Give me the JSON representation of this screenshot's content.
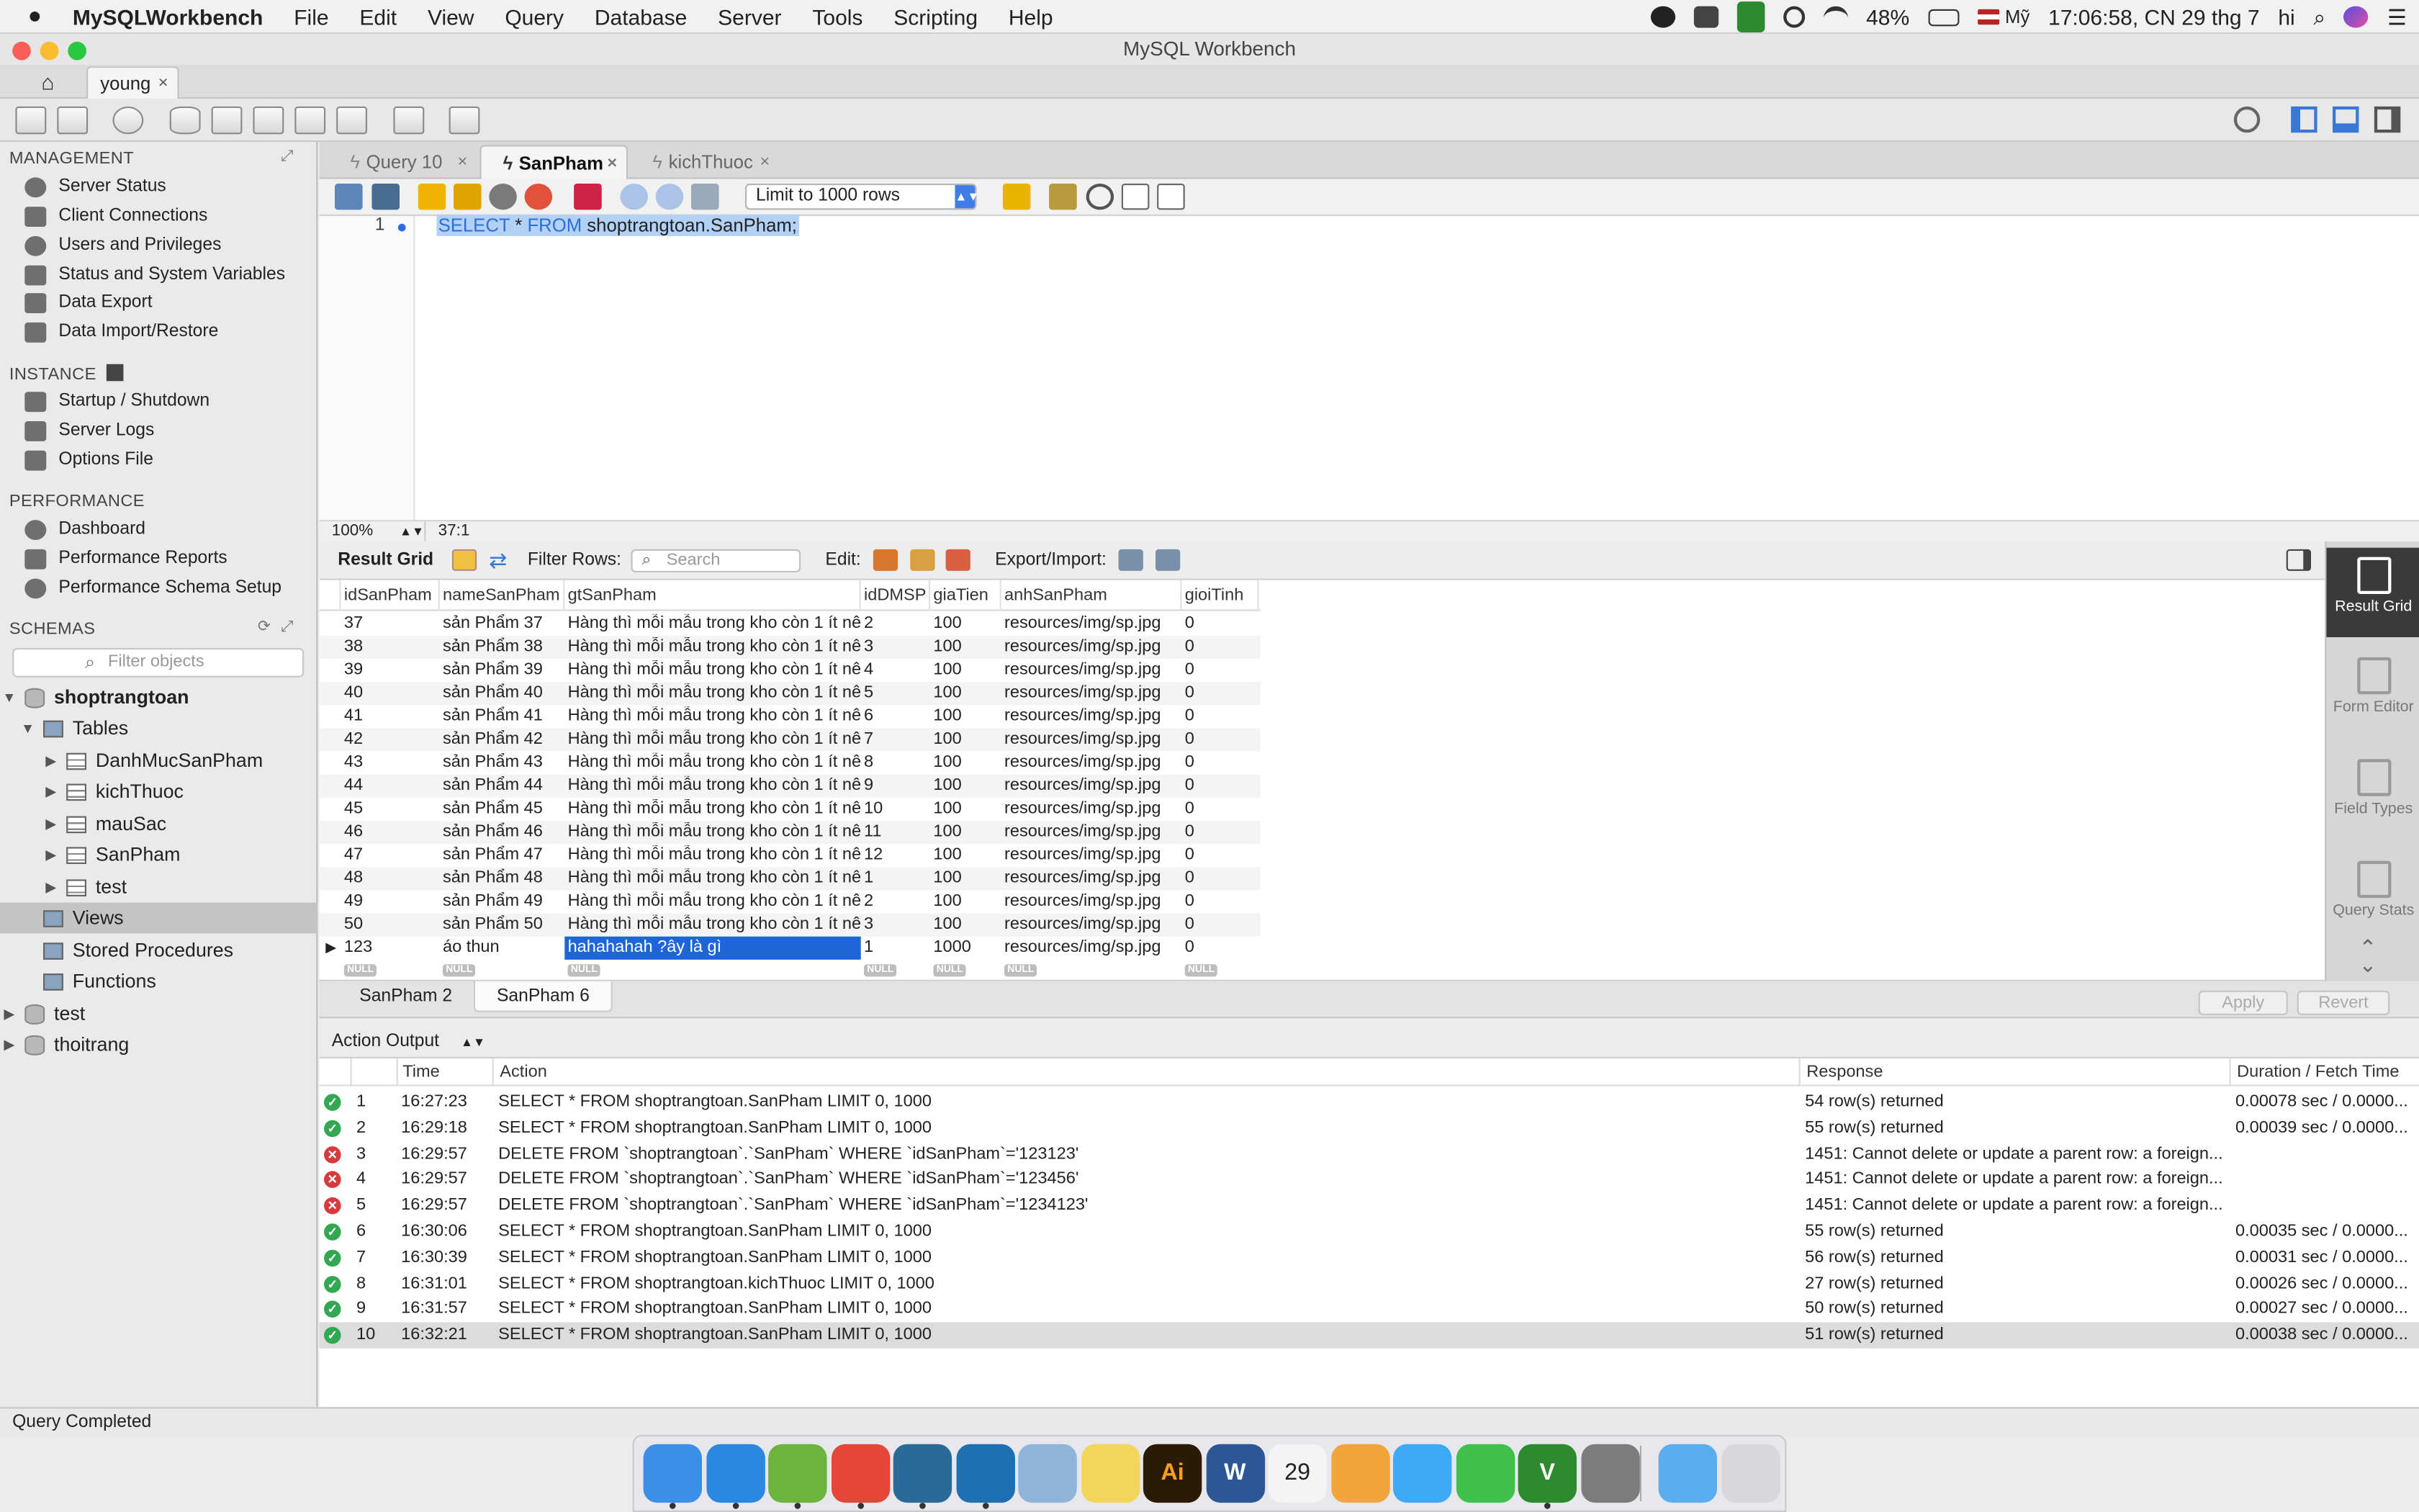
{
  "menubar": {
    "apple": "",
    "app": "MySQLWorkbench",
    "items": [
      "File",
      "Edit",
      "View",
      "Query",
      "Database",
      "Server",
      "Tools",
      "Scripting",
      "Help"
    ],
    "battery": "48%",
    "input_source": "Mỹ",
    "clock": "17:06:58, CN 29 thg 7",
    "user": "hi"
  },
  "window": {
    "title": "MySQL Workbench",
    "conn_tab": "young",
    "conn_tab_close": "×",
    "home_icon": "⌂"
  },
  "sidebar": {
    "management_title": "MANAGEMENT",
    "management": [
      "Server Status",
      "Client Connections",
      "Users and Privileges",
      "Status and System Variables",
      "Data Export",
      "Data Import/Restore"
    ],
    "instance_title": "INSTANCE",
    "instance": [
      "Startup / Shutdown",
      "Server Logs",
      "Options File"
    ],
    "performance_title": "PERFORMANCE",
    "performance": [
      "Dashboard",
      "Performance Reports",
      "Performance Schema Setup"
    ],
    "schemas_title": "SCHEMAS",
    "filter_placeholder": "Filter objects",
    "schema_main": "shoptrangtoan",
    "tables_label": "Tables",
    "tables": [
      "DanhMucSanPham",
      "kichThuoc",
      "mauSac",
      "SanPham",
      "test"
    ],
    "views_label": "Views",
    "procs_label": "Stored Procedures",
    "funcs_label": "Functions",
    "other_schemas": [
      "test",
      "thoitrang"
    ]
  },
  "query_tabs": [
    {
      "label": "Query 10"
    },
    {
      "label": "SanPham"
    },
    {
      "label": "kichThuoc"
    }
  ],
  "editor": {
    "limit": "Limit to 1000 rows",
    "line": "1",
    "kw1": "SELECT",
    "star": " * ",
    "kw2": "FROM",
    "rest": " shoptrangtoan.SanPham;",
    "zoom": "100%",
    "position": "37:1"
  },
  "result_toolbar": {
    "result_grid": "Result Grid",
    "filter_rows": "Filter Rows:",
    "search_placeholder": "Search",
    "edit": "Edit:",
    "export_import": "Export/Import:"
  },
  "grid": {
    "columns": [
      "idSanPham",
      "nameSanPham",
      "gtSanPham",
      "idDMSP",
      "giaTien",
      "anhSanPham",
      "gioiTinh"
    ],
    "rows": [
      [
        "37",
        "sản Phẩm 37",
        "Hàng thì mỗi mẫu trong kho còn 1 ít nê...",
        "2",
        "100",
        "resources/img/sp.jpg",
        "0"
      ],
      [
        "38",
        "sản Phẩm 38",
        "Hàng thì mỗi mẫu trong kho còn 1 ít nê...",
        "3",
        "100",
        "resources/img/sp.jpg",
        "0"
      ],
      [
        "39",
        "sản Phẩm 39",
        "Hàng thì mỗi mẫu trong kho còn 1 ít nê...",
        "4",
        "100",
        "resources/img/sp.jpg",
        "0"
      ],
      [
        "40",
        "sản Phẩm 40",
        "Hàng thì mỗi mẫu trong kho còn 1 ít nê...",
        "5",
        "100",
        "resources/img/sp.jpg",
        "0"
      ],
      [
        "41",
        "sản Phẩm 41",
        "Hàng thì mỗi mẫu trong kho còn 1 ít nê...",
        "6",
        "100",
        "resources/img/sp.jpg",
        "0"
      ],
      [
        "42",
        "sản Phẩm 42",
        "Hàng thì mỗi mẫu trong kho còn 1 ít nê...",
        "7",
        "100",
        "resources/img/sp.jpg",
        "0"
      ],
      [
        "43",
        "sản Phẩm 43",
        "Hàng thì mỗi mẫu trong kho còn 1 ít nê...",
        "8",
        "100",
        "resources/img/sp.jpg",
        "0"
      ],
      [
        "44",
        "sản Phẩm 44",
        "Hàng thì mỗi mẫu trong kho còn 1 ít nê...",
        "9",
        "100",
        "resources/img/sp.jpg",
        "0"
      ],
      [
        "45",
        "sản Phẩm 45",
        "Hàng thì mỗi mẫu trong kho còn 1 ít nê...",
        "10",
        "100",
        "resources/img/sp.jpg",
        "0"
      ],
      [
        "46",
        "sản Phẩm 46",
        "Hàng thì mỗi mẫu trong kho còn 1 ít nê...",
        "11",
        "100",
        "resources/img/sp.jpg",
        "0"
      ],
      [
        "47",
        "sản Phẩm 47",
        "Hàng thì mỗi mẫu trong kho còn 1 ít nê...",
        "12",
        "100",
        "resources/img/sp.jpg",
        "0"
      ],
      [
        "48",
        "sản Phẩm 48",
        "Hàng thì mỗi mẫu trong kho còn 1 ít nê...",
        "1",
        "100",
        "resources/img/sp.jpg",
        "0"
      ],
      [
        "49",
        "sản Phẩm 49",
        "Hàng thì mỗi mẫu trong kho còn 1 ít nê...",
        "2",
        "100",
        "resources/img/sp.jpg",
        "0"
      ],
      [
        "50",
        "sản Phẩm 50",
        "Hàng thì mỗi mẫu trong kho còn 1 ít nê...",
        "3",
        "100",
        "resources/img/sp.jpg",
        "0"
      ],
      [
        "123",
        "áo thun",
        "hahahahah ?ây là gì",
        "1",
        "1000",
        "resources/img/sp.jpg",
        "0"
      ]
    ],
    "null_label": "NULL",
    "current_marker": "▶"
  },
  "right_panel": [
    {
      "label": "Result Grid"
    },
    {
      "label": "Form Editor"
    },
    {
      "label": "Field Types"
    },
    {
      "label": "Query Stats"
    }
  ],
  "result_tabs": [
    "SanPham 2",
    "SanPham 6"
  ],
  "buttons": {
    "apply": "Apply",
    "revert": "Revert"
  },
  "action_output": {
    "title": "Action Output",
    "columns": [
      "Time",
      "Action",
      "Response",
      "Duration / Fetch Time"
    ],
    "rows": [
      {
        "status": "ok",
        "n": "1",
        "time": "16:27:23",
        "action": "SELECT * FROM shoptrangtoan.SanPham LIMIT 0, 1000",
        "response": "54 row(s) returned",
        "duration": "0.00078 sec / 0.0000..."
      },
      {
        "status": "ok",
        "n": "2",
        "time": "16:29:18",
        "action": "SELECT * FROM shoptrangtoan.SanPham LIMIT 0, 1000",
        "response": "55 row(s) returned",
        "duration": "0.00039 sec / 0.0000..."
      },
      {
        "status": "err",
        "n": "3",
        "time": "16:29:57",
        "action": "DELETE FROM `shoptrangtoan`.`SanPham` WHERE `idSanPham`='123123'",
        "response": "1451: Cannot delete or update a parent row: a foreign...",
        "duration": ""
      },
      {
        "status": "err",
        "n": "4",
        "time": "16:29:57",
        "action": "DELETE FROM `shoptrangtoan`.`SanPham` WHERE `idSanPham`='123456'",
        "response": "1451: Cannot delete or update a parent row: a foreign...",
        "duration": ""
      },
      {
        "status": "err",
        "n": "5",
        "time": "16:29:57",
        "action": "DELETE FROM `shoptrangtoan`.`SanPham` WHERE `idSanPham`='1234123'",
        "response": "1451: Cannot delete or update a parent row: a foreign...",
        "duration": ""
      },
      {
        "status": "ok",
        "n": "6",
        "time": "16:30:06",
        "action": "SELECT * FROM shoptrangtoan.SanPham LIMIT 0, 1000",
        "response": "55 row(s) returned",
        "duration": "0.00035 sec / 0.0000..."
      },
      {
        "status": "ok",
        "n": "7",
        "time": "16:30:39",
        "action": "SELECT * FROM shoptrangtoan.SanPham LIMIT 0, 1000",
        "response": "56 row(s) returned",
        "duration": "0.00031 sec / 0.0000..."
      },
      {
        "status": "ok",
        "n": "8",
        "time": "16:31:01",
        "action": "SELECT * FROM shoptrangtoan.kichThuoc LIMIT 0, 1000",
        "response": "27 row(s) returned",
        "duration": "0.00026 sec / 0.0000..."
      },
      {
        "status": "ok",
        "n": "9",
        "time": "16:31:57",
        "action": "SELECT * FROM shoptrangtoan.SanPham LIMIT 0, 1000",
        "response": "50 row(s) returned",
        "duration": "0.00027 sec / 0.0000..."
      },
      {
        "status": "ok",
        "n": "10",
        "time": "16:32:21",
        "action": "SELECT * FROM shoptrangtoan.SanPham LIMIT 0, 1000",
        "response": "51 row(s) returned",
        "duration": "0.00038 sec / 0.0000..."
      }
    ]
  },
  "statusbar": {
    "text": "Query Completed"
  },
  "dock": [
    {
      "icon": "finder-icon",
      "color": "#3d8ee6",
      "glyph": ""
    },
    {
      "icon": "safari-icon",
      "color": "#2b88e0",
      "glyph": ""
    },
    {
      "icon": "spring-tool-icon",
      "color": "#6db33f",
      "glyph": ""
    },
    {
      "icon": "chrome-icon",
      "color": "#e4473a",
      "glyph": ""
    },
    {
      "icon": "mysql-workbench-icon",
      "color": "#2b6a96",
      "glyph": ""
    },
    {
      "icon": "visual-studio-code-icon",
      "color": "#1f6fb3",
      "glyph": ""
    },
    {
      "icon": "virtualbox-icon",
      "color": "#8fb3d9",
      "glyph": ""
    },
    {
      "icon": "notes-icon",
      "color": "#f3d55c",
      "glyph": ""
    },
    {
      "icon": "illustrator-icon",
      "color": "#2b1a05",
      "glyph": "Ai"
    },
    {
      "icon": "word-icon",
      "color": "#2b5797",
      "glyph": "W"
    },
    {
      "icon": "calendar-icon",
      "color": "#f4f4f4",
      "glyph": "29"
    },
    {
      "icon": "photos-icon",
      "color": "#f1a53a",
      "glyph": ""
    },
    {
      "icon": "messages-icon",
      "color": "#3ea9f5",
      "glyph": ""
    },
    {
      "icon": "facetime-icon",
      "color": "#3fc14b",
      "glyph": ""
    },
    {
      "icon": "vim-icon",
      "color": "#2e8a2e",
      "glyph": "V"
    },
    {
      "icon": "system-preferences-icon",
      "color": "#7c7c7c",
      "glyph": ""
    },
    {
      "icon": "downloads-folder-icon",
      "color": "#5aaef0",
      "glyph": ""
    },
    {
      "icon": "trash-icon",
      "color": "#d8d8dc",
      "glyph": ""
    }
  ],
  "colors": {
    "accent": "#3f7ee6",
    "selection": "#2d6be5",
    "ok": "#33a853",
    "error": "#d63a3a"
  }
}
